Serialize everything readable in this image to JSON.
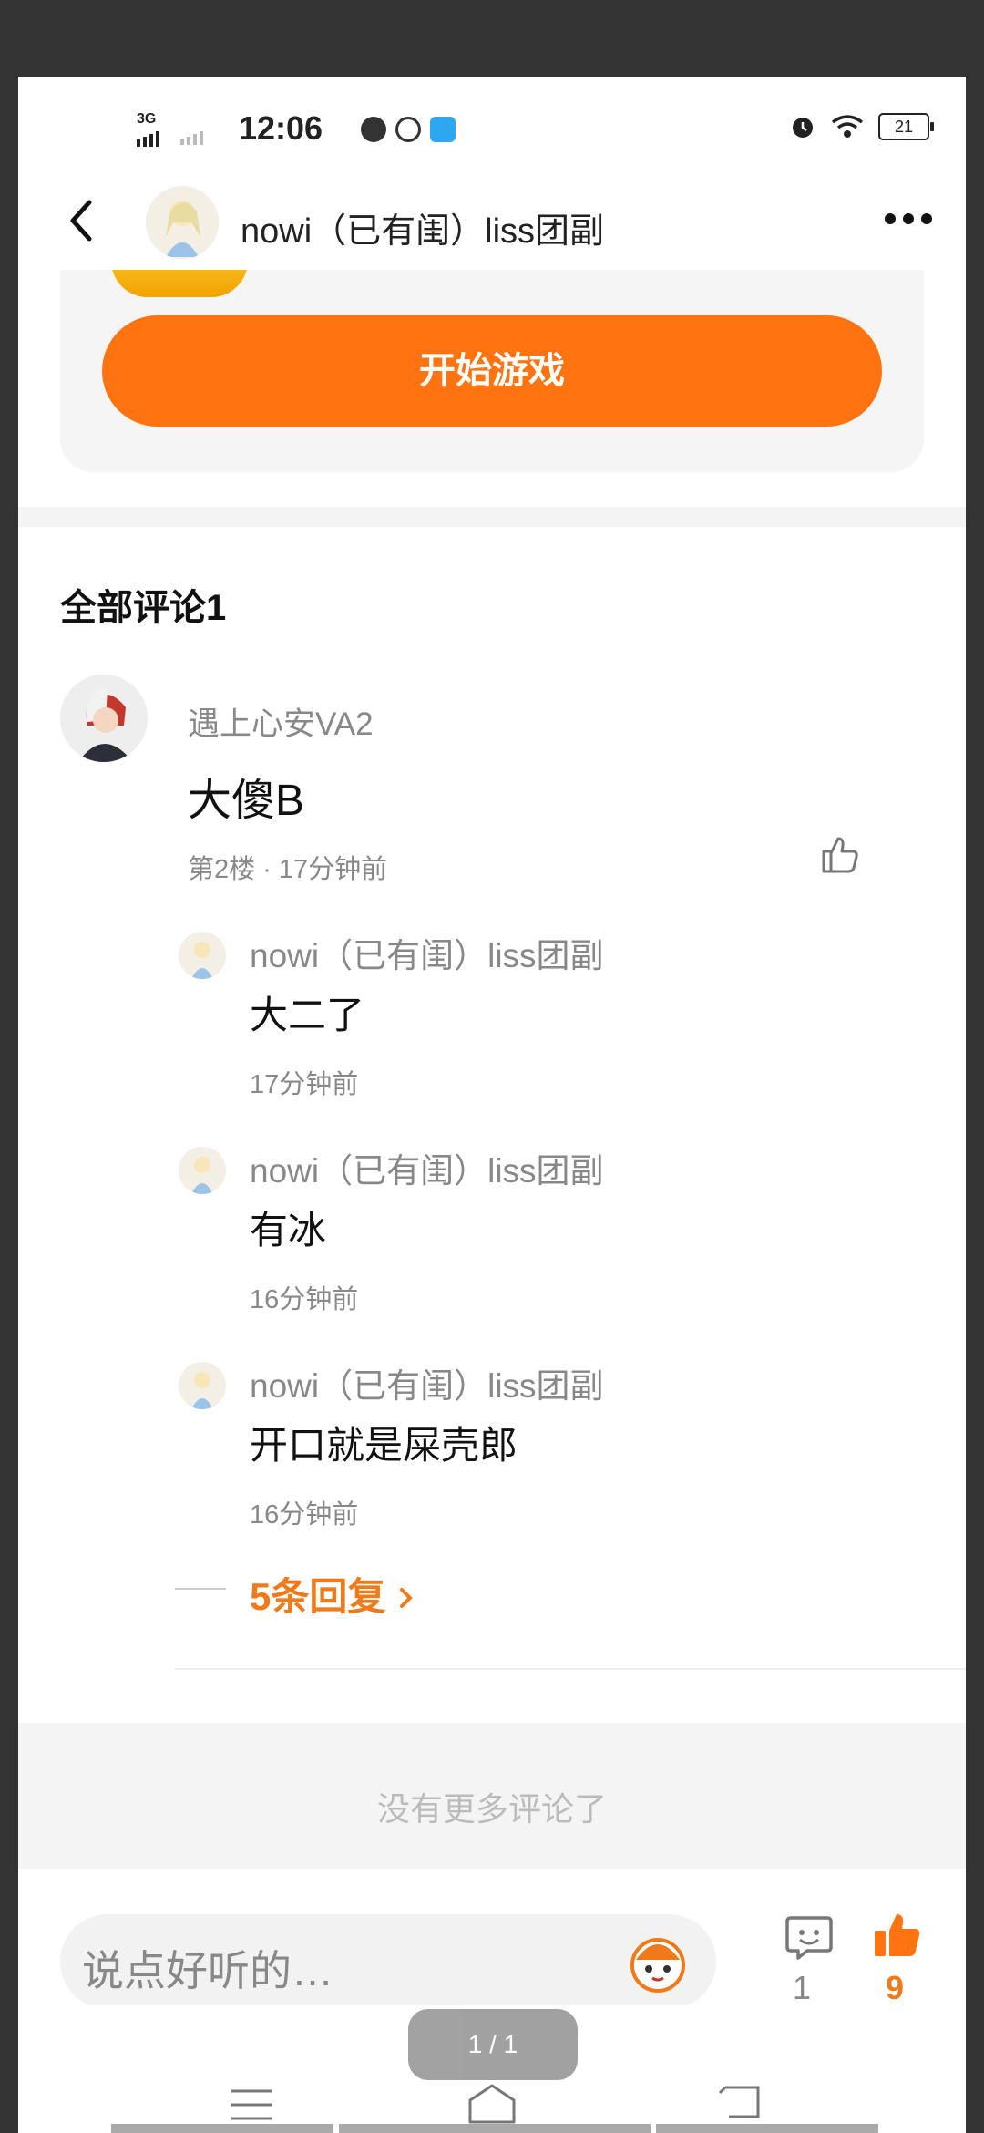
{
  "status_bar": {
    "network": "3G",
    "time": "12:06",
    "battery": "21"
  },
  "header": {
    "title": "nowi（已有闺）liss团副"
  },
  "game_card": {
    "start_label": "开始游戏"
  },
  "comments": {
    "section_title": "全部评论1",
    "main": {
      "user": "遇上心安VA2",
      "text": "大傻B",
      "meta": "第2楼 · 17分钟前"
    },
    "replies": [
      {
        "user": "nowi（已有闺）liss团副",
        "text": "大二了",
        "time": "17分钟前"
      },
      {
        "user": "nowi（已有闺）liss团副",
        "text": "有冰",
        "time": "16分钟前"
      },
      {
        "user": "nowi（已有闺）liss团副",
        "text": "开口就是屎壳郎",
        "time": "16分钟前"
      }
    ],
    "more_replies": "5条回复",
    "no_more": "没有更多评论了"
  },
  "bottom_bar": {
    "input_placeholder": "说点好听的…",
    "comment_count": "1",
    "like_count": "9"
  },
  "overlay": {
    "page_indicator": "1 / 1"
  },
  "colors": {
    "accent": "#ff7310",
    "accent_text": "#f07a1a",
    "muted": "#888888"
  }
}
